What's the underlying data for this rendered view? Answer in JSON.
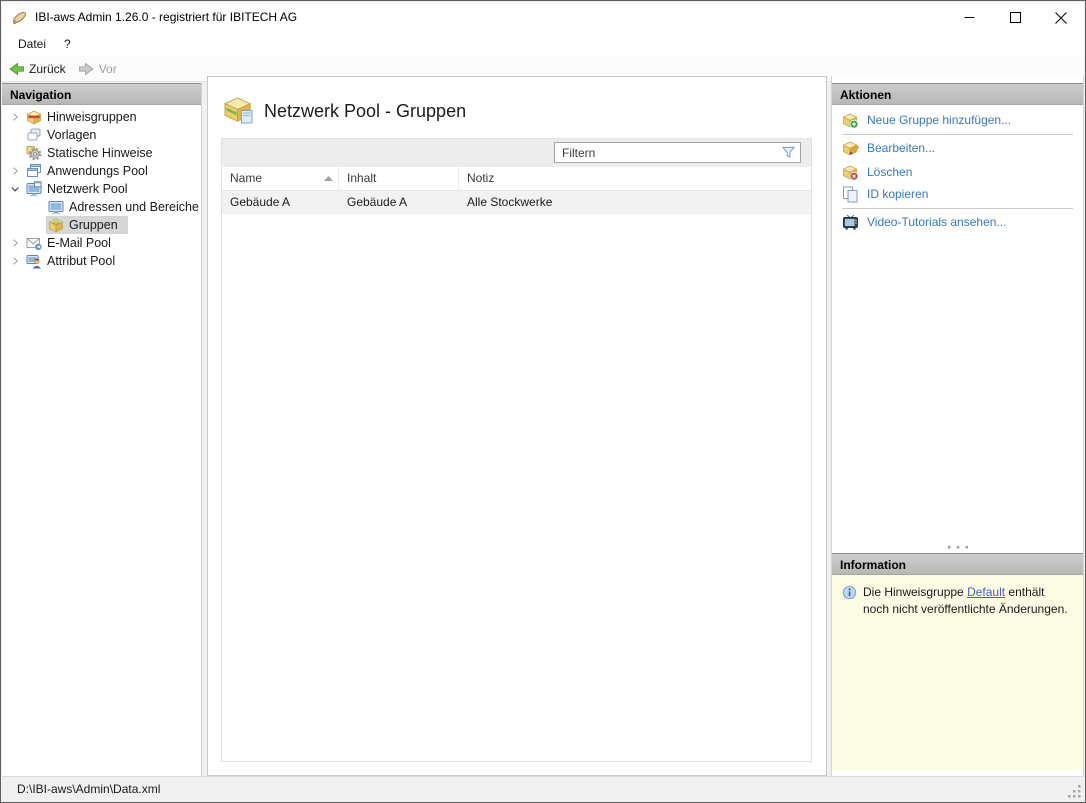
{
  "window": {
    "title": "IBI-aws Admin 1.26.0 - registriert für IBITECH AG",
    "app_icon": "app-icon",
    "controls": [
      {
        "name": "minimize-button",
        "icon": "minimize-icon"
      },
      {
        "name": "maximize-button",
        "icon": "maximize-icon"
      },
      {
        "name": "close-button",
        "icon": "close-icon"
      }
    ]
  },
  "menubar": {
    "items": [
      {
        "label": "Datei"
      },
      {
        "label": "?"
      }
    ]
  },
  "toolbar": {
    "back_label": "Zurück",
    "forward_label": "Vor",
    "back_icon": "back-arrow-icon",
    "forward_icon": "forward-arrow-icon"
  },
  "navigation": {
    "header": "Navigation",
    "items": [
      {
        "label": "Hinweisgruppen",
        "icon": "notice-groups-icon",
        "expander": "collapsed",
        "level": 0,
        "selected": false
      },
      {
        "label": "Vorlagen",
        "icon": "templates-icon",
        "expander": "none",
        "level": 0,
        "selected": false
      },
      {
        "label": "Statische Hinweise",
        "icon": "static-notices-icon",
        "expander": "none",
        "level": 0,
        "selected": false
      },
      {
        "label": "Anwendungs Pool",
        "icon": "application-pool-icon",
        "expander": "collapsed",
        "level": 0,
        "selected": false
      },
      {
        "label": "Netzwerk Pool",
        "icon": "network-pool-icon",
        "expander": "expanded",
        "level": 0,
        "selected": false
      },
      {
        "label": "Adressen und Bereiche",
        "icon": "addresses-icon",
        "expander": "none",
        "level": 1,
        "selected": false
      },
      {
        "label": "Gruppen",
        "icon": "groups-icon",
        "expander": "none",
        "level": 1,
        "selected": true
      },
      {
        "label": "E-Mail Pool",
        "icon": "email-pool-icon",
        "expander": "collapsed",
        "level": 0,
        "selected": false
      },
      {
        "label": "Attribut Pool",
        "icon": "attribute-pool-icon",
        "expander": "collapsed",
        "level": 0,
        "selected": false
      }
    ]
  },
  "main": {
    "title": "Netzwerk Pool - Gruppen",
    "title_icon": "network-group-icon",
    "filter": {
      "placeholder": "Filtern",
      "icon": "filter-funnel-icon"
    },
    "table": {
      "columns": [
        {
          "label": "Name",
          "sort": "asc"
        },
        {
          "label": "Inhalt",
          "sort": "none"
        },
        {
          "label": "Notiz",
          "sort": "none"
        }
      ],
      "rows": [
        {
          "name": "Gebäude A",
          "inhalt": "Gebäude A",
          "notiz": "Alle Stockwerke"
        }
      ]
    }
  },
  "actions": {
    "header": "Aktionen",
    "items": [
      {
        "label": "Neue Gruppe hinzufügen...",
        "icon": "group-add-icon"
      },
      {
        "label": "Bearbeiten...",
        "icon": "group-edit-icon"
      },
      {
        "label": "Löschen",
        "icon": "group-delete-icon"
      },
      {
        "label": "ID kopieren",
        "icon": "copy-icon"
      },
      {
        "label": "Video-Tutorials ansehen...",
        "icon": "video-tutorials-icon"
      }
    ]
  },
  "information": {
    "header": "Information",
    "icon": "info-icon",
    "text_before": "Die Hinweisgruppe ",
    "link": "Default",
    "text_after": " enthält noch nicht veröffentlichte Änderungen."
  },
  "statusbar": {
    "path": "D:\\IBI-aws\\Admin\\Data.xml"
  },
  "colors": {
    "link_blue": "#3579bd",
    "info_background": "#fcfbe4",
    "accent_green": "#72c244",
    "selection_gray": "#d6d6d6",
    "header_gradient_top": "#cdcdcd",
    "header_gradient_bottom": "#b7b7b7"
  }
}
